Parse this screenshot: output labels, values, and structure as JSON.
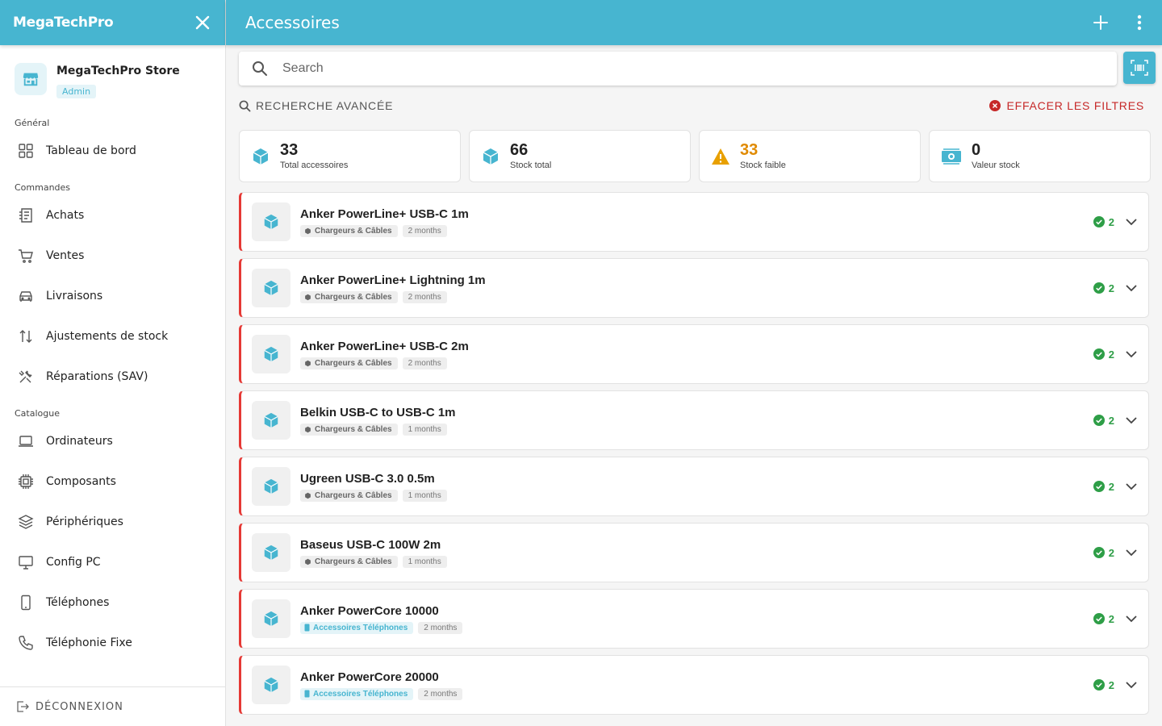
{
  "sidebar": {
    "brand": "MegaTechPro",
    "store_name": "MegaTechPro Store",
    "role": "Admin",
    "sections": {
      "general": "Général",
      "orders": "Commandes",
      "catalog": "Catalogue"
    },
    "items": {
      "dashboard": "Tableau de bord",
      "purchases": "Achats",
      "sales": "Ventes",
      "deliveries": "Livraisons",
      "stock_adjust": "Ajustements de stock",
      "repairs": "Réparations (SAV)",
      "computers": "Ordinateurs",
      "components": "Composants",
      "peripherals": "Périphériques",
      "config_pc": "Config PC",
      "phones": "Téléphones",
      "landline": "Téléphonie Fixe"
    },
    "logout": "DÉCONNEXION"
  },
  "topbar": {
    "title": "Accessoires",
    "add_icon": "plus-icon",
    "menu_icon": "more-vertical-icon"
  },
  "search": {
    "placeholder": "Search",
    "value": ""
  },
  "filters": {
    "advanced": "RECHERCHE AVANCÉE",
    "clear": "EFFACER LES FILTRES"
  },
  "stats": [
    {
      "value": "33",
      "caption": "Total accessoires",
      "color": "#222222"
    },
    {
      "value": "66",
      "caption": "Stock total",
      "color": "#222222"
    },
    {
      "value": "33",
      "caption": "Stock faible",
      "color": "#e08a00"
    },
    {
      "value": "0",
      "caption": "Valeur stock",
      "color": "#222222"
    }
  ],
  "products": [
    {
      "name": "Anker PowerLine+ USB-C 1m",
      "category": "Chargeurs & Câbles",
      "age": "2 months",
      "qty": "2"
    },
    {
      "name": "Anker PowerLine+ Lightning 1m",
      "category": "Chargeurs & Câbles",
      "age": "2 months",
      "qty": "2"
    },
    {
      "name": "Anker PowerLine+ USB-C 2m",
      "category": "Chargeurs & Câbles",
      "age": "2 months",
      "qty": "2"
    },
    {
      "name": "Belkin USB-C to USB-C 1m",
      "category": "Chargeurs & Câbles",
      "age": "1 months",
      "qty": "2"
    },
    {
      "name": "Ugreen USB-C 3.0 0.5m",
      "category": "Chargeurs & Câbles",
      "age": "1 months",
      "qty": "2"
    },
    {
      "name": "Baseus USB-C 100W 2m",
      "category": "Chargeurs & Câbles",
      "age": "1 months",
      "qty": "2"
    },
    {
      "name": "Anker PowerCore 10000",
      "category": "Accessoires Téléphones",
      "age": "2 months",
      "qty": "2"
    },
    {
      "name": "Anker PowerCore 20000",
      "category": "Accessoires Téléphones",
      "age": "2 months",
      "qty": "2"
    }
  ],
  "colors": {
    "accent": "#47b5d0",
    "low_stock": "#e08a00",
    "danger": "#c62828",
    "ok": "#2e9e47",
    "row_border": "#e53935"
  }
}
